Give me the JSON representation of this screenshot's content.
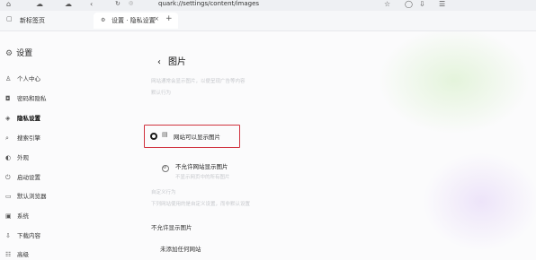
{
  "browser": {
    "address": "quark://settings/content/images",
    "tabs": [
      {
        "label": "新标签页"
      },
      {
        "label": "设置 · 隐私设置"
      }
    ],
    "new_tab_icon": "plus-icon"
  },
  "sidebar": {
    "title": "设置",
    "items": [
      {
        "label": "个人中心",
        "icon": "user-icon"
      },
      {
        "label": "密码和隐私",
        "icon": "lock-icon"
      },
      {
        "label": "隐私设置",
        "icon": "shield-icon",
        "active": true
      },
      {
        "label": "搜索引擎",
        "icon": "search-icon"
      },
      {
        "label": "外观",
        "icon": "palette-icon"
      },
      {
        "label": "启动设置",
        "icon": "power-icon"
      },
      {
        "label": "默认浏览器",
        "icon": "browser-icon"
      },
      {
        "label": "系统",
        "icon": "system-icon"
      },
      {
        "label": "下载内容",
        "icon": "download-icon"
      },
      {
        "label": "高级",
        "icon": "advanced-icon"
      }
    ]
  },
  "main": {
    "title": "图片",
    "blurred_description": "网站通常会显示图片，以便呈现广告等内容",
    "blurred_sub": "默认行为",
    "option_allow": "网站可以显示图片",
    "option_block": "不允许网站显示图片",
    "option_block_desc": "不显示网页中的所有图片",
    "custom_behavior": "自定义行为",
    "custom_desc": "下列网站使用的是自定义设置，而非默认设置",
    "not_allowed_label": "不允许显示图片",
    "no_sites": "未添加任何网站"
  },
  "colors": {
    "highlight": "#d0323e"
  }
}
